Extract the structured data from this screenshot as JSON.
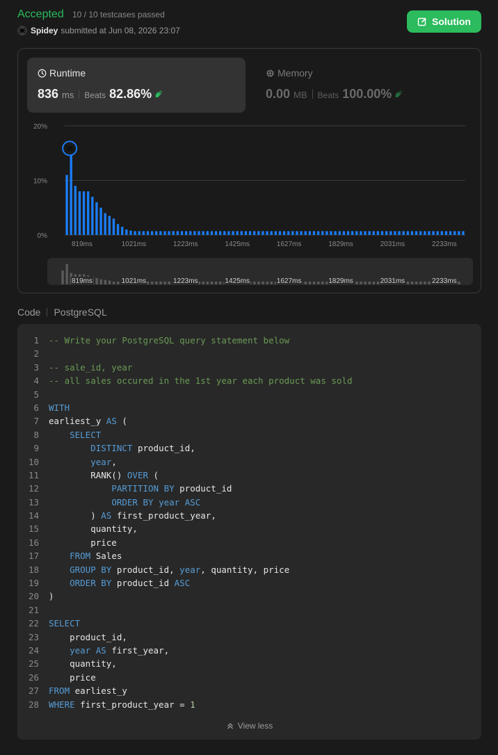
{
  "header": {
    "status": "Accepted",
    "testcases": "10 / 10 testcases passed",
    "submitter": "Spidey",
    "submitted_at": "submitted at Jun 08, 2026 23:07",
    "solution_button": "Solution"
  },
  "runtime": {
    "title": "Runtime",
    "value": "836",
    "unit": "ms",
    "beats_label": "Beats",
    "beats_pct": "82.86%"
  },
  "memory": {
    "title": "Memory",
    "value": "0.00",
    "unit": "MB",
    "beats_label": "Beats",
    "beats_pct": "100.00%"
  },
  "chart_data": {
    "type": "bar",
    "y_ticks": [
      "20%",
      "10%",
      "0%"
    ],
    "ylim": [
      0,
      20
    ],
    "grid": true,
    "x_ticks": [
      "819ms",
      "1021ms",
      "1223ms",
      "1425ms",
      "1627ms",
      "1829ms",
      "2031ms",
      "2233ms"
    ],
    "values": [
      11,
      16,
      9,
      8,
      8,
      8,
      7,
      6,
      5,
      4,
      3.5,
      3,
      2,
      1.5,
      1,
      0.8,
      0.7,
      0.7,
      0.7,
      0.7,
      0.7,
      0.7,
      0.7,
      0.7,
      0.7,
      0.7,
      0.7,
      0.7,
      0.7,
      0.7,
      0.7,
      0.7,
      0.7,
      0.7,
      0.7,
      0.7,
      0.7,
      0.7,
      0.7,
      0.7,
      0.7,
      0.7,
      0.7,
      0.7,
      0.7,
      0.7,
      0.7,
      0.7,
      0.7,
      0.7,
      0.7,
      0.7,
      0.7,
      0.7,
      0.7,
      0.7,
      0.7,
      0.7,
      0.7,
      0.7,
      0.7,
      0.7,
      0.7,
      0.7,
      0.7,
      0.7,
      0.7,
      0.7,
      0.7,
      0.7,
      0.7,
      0.7,
      0.7,
      0.7,
      0.7,
      0.7,
      0.7,
      0.7,
      0.7,
      0.7,
      0.7,
      0.7,
      0.7,
      0.7,
      0.7,
      0.7,
      0.7,
      0.7,
      0.7,
      0.7,
      0.7,
      0.7,
      0.7,
      0.7
    ],
    "highlight_index": 1,
    "bar_color": "#1a7cf5",
    "brush_bar_color": "#5a5a5a"
  },
  "code": {
    "label": "Code",
    "language": "PostgreSQL",
    "lines": [
      [
        [
          "-- Write your PostgreSQL query statement below",
          "comment"
        ]
      ],
      [],
      [
        [
          "-- sale_id, year",
          "comment"
        ]
      ],
      [
        [
          "-- all sales occured in the 1st year each product was sold",
          "comment"
        ]
      ],
      [],
      [
        [
          "WITH",
          "kw"
        ]
      ],
      [
        [
          "earliest_y ",
          ""
        ],
        [
          "AS",
          "kw"
        ],
        [
          " (",
          ""
        ]
      ],
      [
        [
          "    ",
          ""
        ],
        [
          "SELECT",
          "kw"
        ]
      ],
      [
        [
          "        ",
          ""
        ],
        [
          "DISTINCT",
          "kw"
        ],
        [
          " product_id,",
          ""
        ]
      ],
      [
        [
          "        ",
          ""
        ],
        [
          "year",
          "kw"
        ],
        [
          ",",
          ""
        ]
      ],
      [
        [
          "        RANK() ",
          ""
        ],
        [
          "OVER",
          "kw"
        ],
        [
          " (",
          ""
        ]
      ],
      [
        [
          "            ",
          ""
        ],
        [
          "PARTITION BY",
          "kw"
        ],
        [
          " product_id",
          ""
        ]
      ],
      [
        [
          "            ",
          ""
        ],
        [
          "ORDER BY",
          "kw"
        ],
        [
          " ",
          ""
        ],
        [
          "year",
          "kw"
        ],
        [
          " ",
          ""
        ],
        [
          "ASC",
          "kw"
        ]
      ],
      [
        [
          "        ) ",
          ""
        ],
        [
          "AS",
          "kw"
        ],
        [
          " first_product_year,",
          ""
        ]
      ],
      [
        [
          "        quantity,",
          ""
        ]
      ],
      [
        [
          "        price",
          ""
        ]
      ],
      [
        [
          "    ",
          ""
        ],
        [
          "FROM",
          "kw"
        ],
        [
          " Sales",
          ""
        ]
      ],
      [
        [
          "    ",
          ""
        ],
        [
          "GROUP BY",
          "kw"
        ],
        [
          " product_id, ",
          ""
        ],
        [
          "year",
          "kw"
        ],
        [
          ", quantity, price",
          ""
        ]
      ],
      [
        [
          "    ",
          ""
        ],
        [
          "ORDER BY",
          "kw"
        ],
        [
          " product_id ",
          ""
        ],
        [
          "ASC",
          "kw"
        ]
      ],
      [
        [
          ")",
          ""
        ]
      ],
      [],
      [
        [
          "SELECT",
          "kw"
        ]
      ],
      [
        [
          "    product_id,",
          ""
        ]
      ],
      [
        [
          "    ",
          ""
        ],
        [
          "year",
          "kw"
        ],
        [
          " ",
          ""
        ],
        [
          "AS",
          "kw"
        ],
        [
          " first_year,",
          ""
        ]
      ],
      [
        [
          "    quantity,",
          ""
        ]
      ],
      [
        [
          "    price",
          ""
        ]
      ],
      [
        [
          "FROM",
          "kw"
        ],
        [
          " earliest_y",
          ""
        ]
      ],
      [
        [
          "WHERE",
          "kw"
        ],
        [
          " first_product_year = ",
          ""
        ],
        [
          "1",
          "num"
        ]
      ]
    ],
    "view_less": "View less"
  },
  "icons": {
    "solution": "edit-icon",
    "runtime": "clock-icon",
    "memory": "chip-icon",
    "beats": "clap-icon",
    "view_less": "double-chevron-up-icon"
  },
  "colors": {
    "accent_green": "#2cbb5d",
    "bar_blue": "#1a7cf5"
  }
}
